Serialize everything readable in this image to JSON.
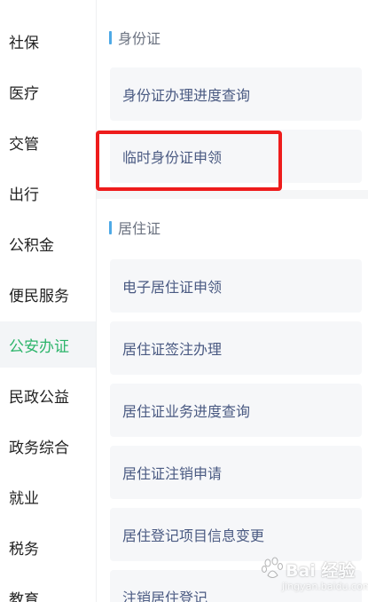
{
  "sidebar": {
    "items": [
      {
        "label": "社保"
      },
      {
        "label": "医疗"
      },
      {
        "label": "交管"
      },
      {
        "label": "出行"
      },
      {
        "label": "公积金"
      },
      {
        "label": "便民服务"
      },
      {
        "label": "公安办证",
        "active": true
      },
      {
        "label": "民政公益"
      },
      {
        "label": "政务综合"
      },
      {
        "label": "就业"
      },
      {
        "label": "税务"
      },
      {
        "label": "教育"
      }
    ]
  },
  "sections": [
    {
      "title": "身份证",
      "items": [
        {
          "label": "身份证办理进度查询"
        },
        {
          "label": "临时身份证申领"
        }
      ]
    },
    {
      "title": "居住证",
      "items": [
        {
          "label": "电子居住证申领"
        },
        {
          "label": "居住证签注办理"
        },
        {
          "label": "居住证业务进度查询"
        },
        {
          "label": "居住证注销申请"
        },
        {
          "label": "居住登记项目信息变更"
        },
        {
          "label": "注销居住登记"
        }
      ]
    }
  ],
  "watermark": {
    "text": "Bai 经验",
    "url": "jingyan.baidu.com"
  },
  "colors": {
    "active": "#2db56b",
    "accent_bar": "#4ea9e6",
    "card_text": "#4a5a82",
    "highlight": "#ee1c1c"
  }
}
